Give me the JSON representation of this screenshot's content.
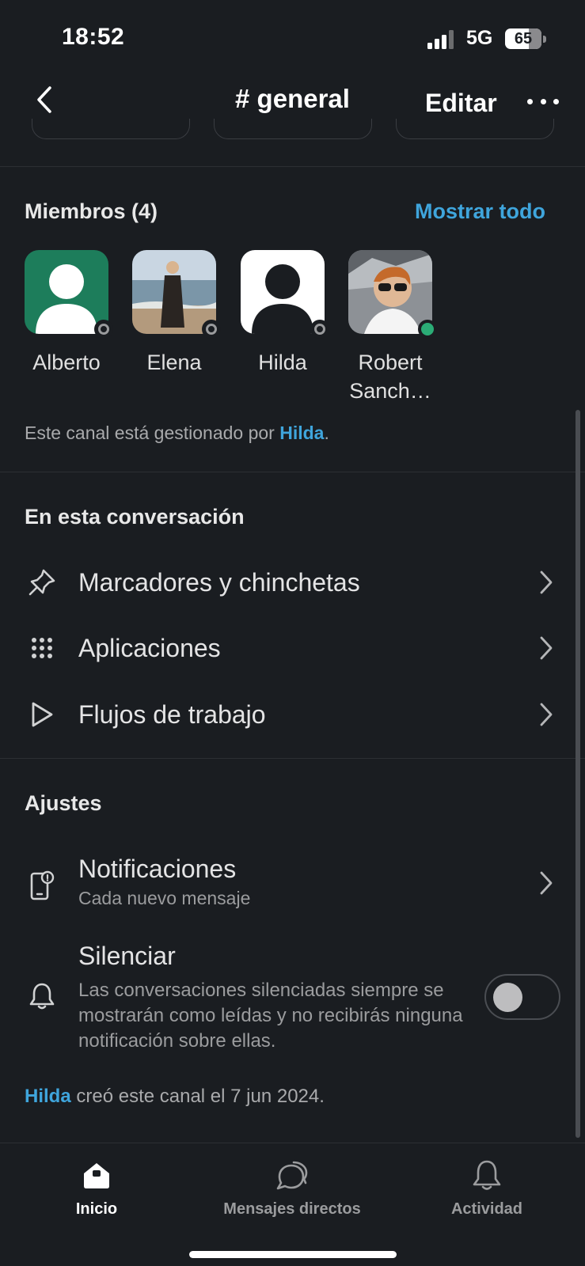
{
  "status_bar": {
    "time": "18:52",
    "network": "5G",
    "battery_percent": "65",
    "battery_level": 0.65
  },
  "header": {
    "title": "# general",
    "edit_label": "Editar"
  },
  "members": {
    "title": "Miembros (4)",
    "show_all": "Mostrar todo",
    "list": [
      {
        "name": "Alberto",
        "presence": "away"
      },
      {
        "name": "Elena",
        "presence": "away"
      },
      {
        "name": "Hilda",
        "presence": "away"
      },
      {
        "name": "Robert Sanch…",
        "presence": "active"
      }
    ],
    "managed_prefix": "Este canal está gestionado por",
    "managed_by": "Hilda",
    "managed_suffix": "."
  },
  "conversation": {
    "title": "En esta conversación",
    "items": [
      {
        "label": "Marcadores y chinchetas",
        "icon": "pin-icon"
      },
      {
        "label": "Aplicaciones",
        "icon": "apps-grid-icon"
      },
      {
        "label": "Flujos de trabajo",
        "icon": "play-icon"
      }
    ]
  },
  "settings": {
    "title": "Ajustes",
    "notifications": {
      "label": "Notificaciones",
      "value": "Cada nuevo mensaje"
    },
    "mute": {
      "label": "Silenciar",
      "description": "Las conversaciones silenciadas siempre se mostrarán como leídas y no recibirás ninguna notificación sobre ellas.",
      "enabled": false
    }
  },
  "footer": {
    "creator": "Hilda",
    "created_text": "creó este canal el 7 jun 2024."
  },
  "tabbar": {
    "tabs": [
      {
        "label": "Inicio",
        "active": true
      },
      {
        "label": "Mensajes directos",
        "active": false
      },
      {
        "label": "Actividad",
        "active": false
      }
    ]
  },
  "colors": {
    "background": "#1a1d21",
    "link": "#3fa5dc",
    "active_presence": "#2bac76",
    "avatar_green": "#1d7d5b"
  }
}
